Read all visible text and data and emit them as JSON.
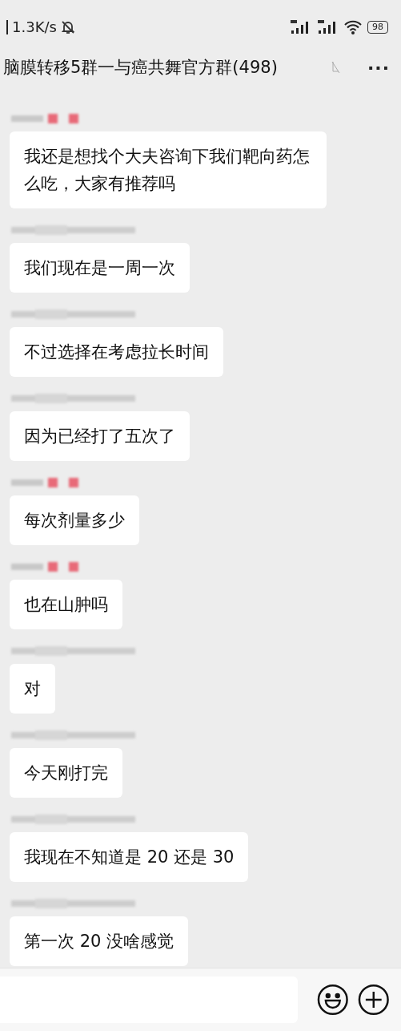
{
  "status_bar": {
    "speed": "1.3K/s",
    "battery": "98"
  },
  "header": {
    "title": "脑膜转移5群一与癌共舞官方群(498)",
    "more": "···"
  },
  "messages": [
    {
      "sender": {
        "kind": "marked"
      },
      "text": "我还是想找个大夫咨询下我们靶向药怎么吃，大家有推荐吗"
    },
    {
      "sender": {
        "kind": "plain"
      },
      "text": "我们现在是一周一次"
    },
    {
      "sender": {
        "kind": "plain"
      },
      "text": "不过选择在考虑拉长时间"
    },
    {
      "sender": {
        "kind": "plain"
      },
      "text": "因为已经打了五次了"
    },
    {
      "sender": {
        "kind": "marked"
      },
      "text": "每次剂量多少"
    },
    {
      "sender": {
        "kind": "marked"
      },
      "text": "也在山肿吗"
    },
    {
      "sender": {
        "kind": "plain"
      },
      "text": "对"
    },
    {
      "sender": {
        "kind": "plain"
      },
      "text": "今天刚打完"
    },
    {
      "sender": {
        "kind": "plain"
      },
      "text": "我现在不知道是 20 还是 30"
    },
    {
      "sender": {
        "kind": "plain"
      },
      "text": "第一次 20 没啥感觉"
    }
  ]
}
